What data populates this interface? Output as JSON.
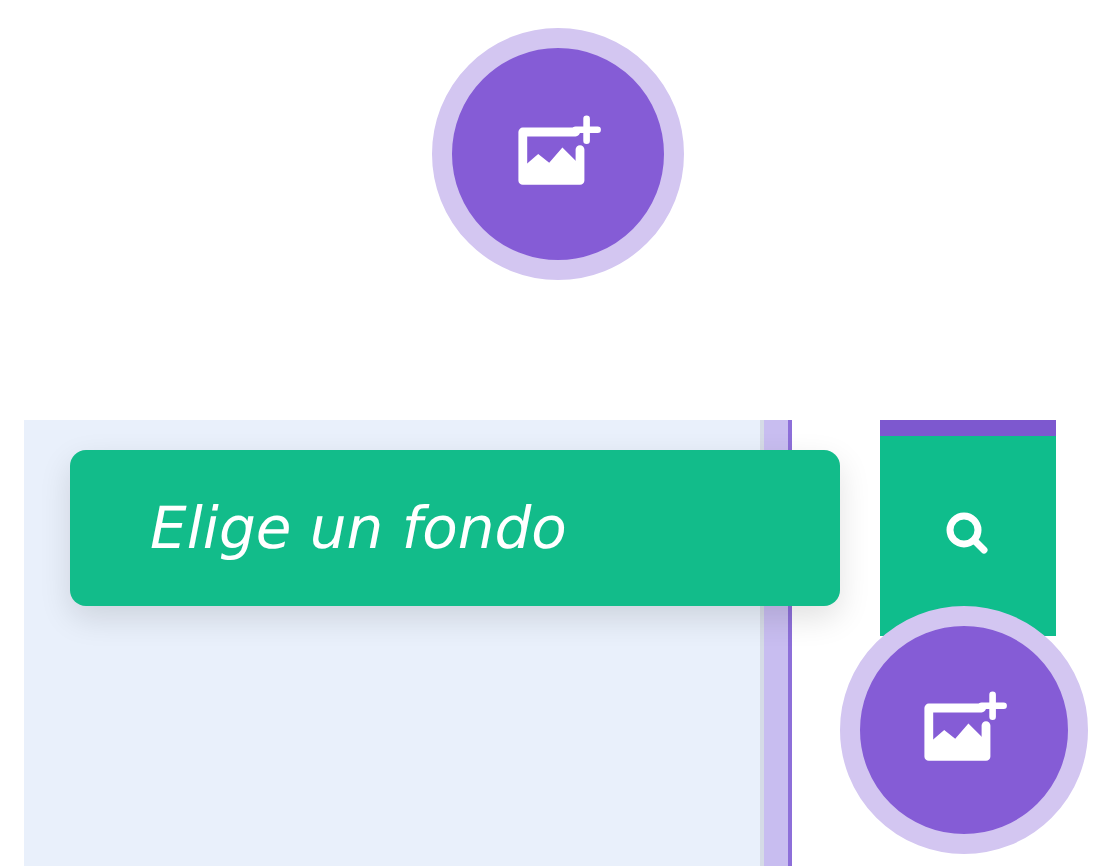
{
  "tooltip": {
    "text": "Elige un fondo"
  }
}
